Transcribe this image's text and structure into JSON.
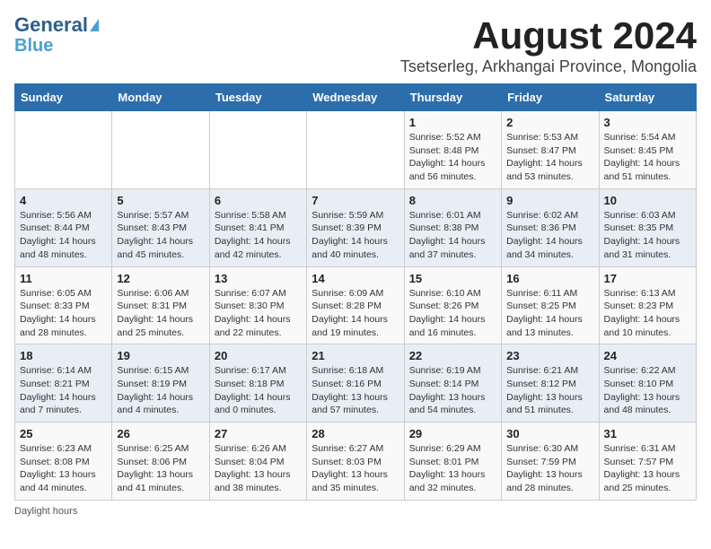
{
  "logo": {
    "line1": "General",
    "line2": "Blue"
  },
  "title": "August 2024",
  "subtitle": "Tsetserleg, Arkhangai Province, Mongolia",
  "days_of_week": [
    "Sunday",
    "Monday",
    "Tuesday",
    "Wednesday",
    "Thursday",
    "Friday",
    "Saturday"
  ],
  "footer": "Daylight hours",
  "weeks": [
    [
      {
        "day": "",
        "info": ""
      },
      {
        "day": "",
        "info": ""
      },
      {
        "day": "",
        "info": ""
      },
      {
        "day": "",
        "info": ""
      },
      {
        "day": "1",
        "info": "Sunrise: 5:52 AM\nSunset: 8:48 PM\nDaylight: 14 hours\nand 56 minutes."
      },
      {
        "day": "2",
        "info": "Sunrise: 5:53 AM\nSunset: 8:47 PM\nDaylight: 14 hours\nand 53 minutes."
      },
      {
        "day": "3",
        "info": "Sunrise: 5:54 AM\nSunset: 8:45 PM\nDaylight: 14 hours\nand 51 minutes."
      }
    ],
    [
      {
        "day": "4",
        "info": "Sunrise: 5:56 AM\nSunset: 8:44 PM\nDaylight: 14 hours\nand 48 minutes."
      },
      {
        "day": "5",
        "info": "Sunrise: 5:57 AM\nSunset: 8:43 PM\nDaylight: 14 hours\nand 45 minutes."
      },
      {
        "day": "6",
        "info": "Sunrise: 5:58 AM\nSunset: 8:41 PM\nDaylight: 14 hours\nand 42 minutes."
      },
      {
        "day": "7",
        "info": "Sunrise: 5:59 AM\nSunset: 8:39 PM\nDaylight: 14 hours\nand 40 minutes."
      },
      {
        "day": "8",
        "info": "Sunrise: 6:01 AM\nSunset: 8:38 PM\nDaylight: 14 hours\nand 37 minutes."
      },
      {
        "day": "9",
        "info": "Sunrise: 6:02 AM\nSunset: 8:36 PM\nDaylight: 14 hours\nand 34 minutes."
      },
      {
        "day": "10",
        "info": "Sunrise: 6:03 AM\nSunset: 8:35 PM\nDaylight: 14 hours\nand 31 minutes."
      }
    ],
    [
      {
        "day": "11",
        "info": "Sunrise: 6:05 AM\nSunset: 8:33 PM\nDaylight: 14 hours\nand 28 minutes."
      },
      {
        "day": "12",
        "info": "Sunrise: 6:06 AM\nSunset: 8:31 PM\nDaylight: 14 hours\nand 25 minutes."
      },
      {
        "day": "13",
        "info": "Sunrise: 6:07 AM\nSunset: 8:30 PM\nDaylight: 14 hours\nand 22 minutes."
      },
      {
        "day": "14",
        "info": "Sunrise: 6:09 AM\nSunset: 8:28 PM\nDaylight: 14 hours\nand 19 minutes."
      },
      {
        "day": "15",
        "info": "Sunrise: 6:10 AM\nSunset: 8:26 PM\nDaylight: 14 hours\nand 16 minutes."
      },
      {
        "day": "16",
        "info": "Sunrise: 6:11 AM\nSunset: 8:25 PM\nDaylight: 14 hours\nand 13 minutes."
      },
      {
        "day": "17",
        "info": "Sunrise: 6:13 AM\nSunset: 8:23 PM\nDaylight: 14 hours\nand 10 minutes."
      }
    ],
    [
      {
        "day": "18",
        "info": "Sunrise: 6:14 AM\nSunset: 8:21 PM\nDaylight: 14 hours\nand 7 minutes."
      },
      {
        "day": "19",
        "info": "Sunrise: 6:15 AM\nSunset: 8:19 PM\nDaylight: 14 hours\nand 4 minutes."
      },
      {
        "day": "20",
        "info": "Sunrise: 6:17 AM\nSunset: 8:18 PM\nDaylight: 14 hours\nand 0 minutes."
      },
      {
        "day": "21",
        "info": "Sunrise: 6:18 AM\nSunset: 8:16 PM\nDaylight: 13 hours\nand 57 minutes."
      },
      {
        "day": "22",
        "info": "Sunrise: 6:19 AM\nSunset: 8:14 PM\nDaylight: 13 hours\nand 54 minutes."
      },
      {
        "day": "23",
        "info": "Sunrise: 6:21 AM\nSunset: 8:12 PM\nDaylight: 13 hours\nand 51 minutes."
      },
      {
        "day": "24",
        "info": "Sunrise: 6:22 AM\nSunset: 8:10 PM\nDaylight: 13 hours\nand 48 minutes."
      }
    ],
    [
      {
        "day": "25",
        "info": "Sunrise: 6:23 AM\nSunset: 8:08 PM\nDaylight: 13 hours\nand 44 minutes."
      },
      {
        "day": "26",
        "info": "Sunrise: 6:25 AM\nSunset: 8:06 PM\nDaylight: 13 hours\nand 41 minutes."
      },
      {
        "day": "27",
        "info": "Sunrise: 6:26 AM\nSunset: 8:04 PM\nDaylight: 13 hours\nand 38 minutes."
      },
      {
        "day": "28",
        "info": "Sunrise: 6:27 AM\nSunset: 8:03 PM\nDaylight: 13 hours\nand 35 minutes."
      },
      {
        "day": "29",
        "info": "Sunrise: 6:29 AM\nSunset: 8:01 PM\nDaylight: 13 hours\nand 32 minutes."
      },
      {
        "day": "30",
        "info": "Sunrise: 6:30 AM\nSunset: 7:59 PM\nDaylight: 13 hours\nand 28 minutes."
      },
      {
        "day": "31",
        "info": "Sunrise: 6:31 AM\nSunset: 7:57 PM\nDaylight: 13 hours\nand 25 minutes."
      }
    ]
  ]
}
